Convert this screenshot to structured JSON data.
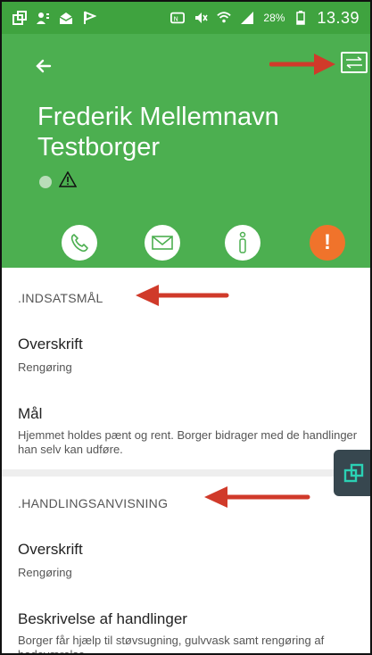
{
  "status_bar": {
    "battery_text": "28%",
    "time": "13.39"
  },
  "header": {
    "name_line1": "Frederik Mellemnavn",
    "name_line2": "Testborger",
    "warning_glyph": "⚠"
  },
  "actions": [
    {
      "icon": "phone-icon"
    },
    {
      "icon": "mail-icon"
    },
    {
      "icon": "info-icon"
    },
    {
      "icon": "alert-icon",
      "label": "!"
    }
  ],
  "sections": [
    {
      "heading": ".INDSATSMÅL",
      "fields": [
        {
          "label": "Overskrift",
          "value": "Rengøring"
        },
        {
          "label": "Mål",
          "value": "Hjemmet holdes pænt og rent. Borger bidrager med de handlinger han selv kan udføre."
        }
      ]
    },
    {
      "heading": ".HANDLINGSANVISNING",
      "fields": [
        {
          "label": "Overskrift",
          "value": "Rengøring"
        },
        {
          "label": "Beskrivelse af handlinger",
          "value": "Borger får hjælp til støvsugning, gulvvask samt rengøring af badeværelse."
        }
      ]
    }
  ],
  "colors": {
    "header_green": "#4caf50",
    "status_green": "#3fa33f",
    "alert_orange": "#f0732b",
    "annotation_red": "#d03a2a",
    "fab_dark": "#37474f"
  }
}
